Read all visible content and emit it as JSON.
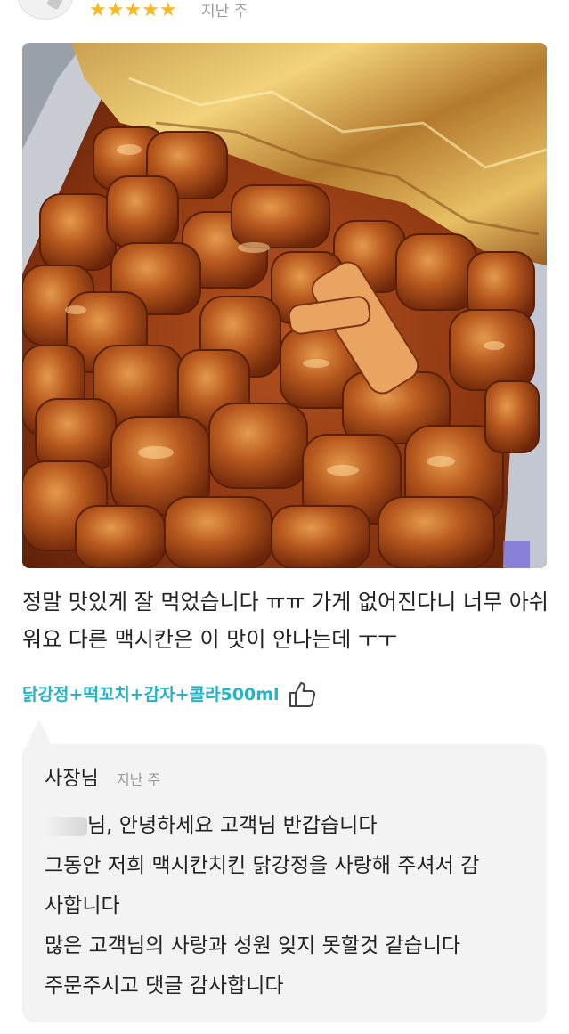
{
  "review": {
    "rating": 5,
    "stars": "★★★★★",
    "date": "지난 주",
    "text": "정말 맛있게 잘 먹었습니다 ㅠㅠ 가게 없어진다니 너무 아쉬워요 다른 맥시칸은 이 맛이 안나는데 ㅜㅜ",
    "menu": "닭강정+떡꼬치+감자+콜라500ml",
    "like_icon": "thumbs-up-icon"
  },
  "reply": {
    "author": "사장님",
    "date": "지난 주",
    "lines": [
      "님, 안녕하세요 고객님 반갑습니다",
      "그동안 저희 맥시칸치킨 닭강정을 사랑해 주셔서 감",
      "사합니다",
      "많은 고객님의 사랑과 성원 잊지 못할것 같습니다",
      "주문주시고 댓글 감사합니다"
    ]
  },
  "colors": {
    "star": "#f5b826",
    "menu_tag": "#21b4c4",
    "reply_bg": "#f3f3f3"
  }
}
